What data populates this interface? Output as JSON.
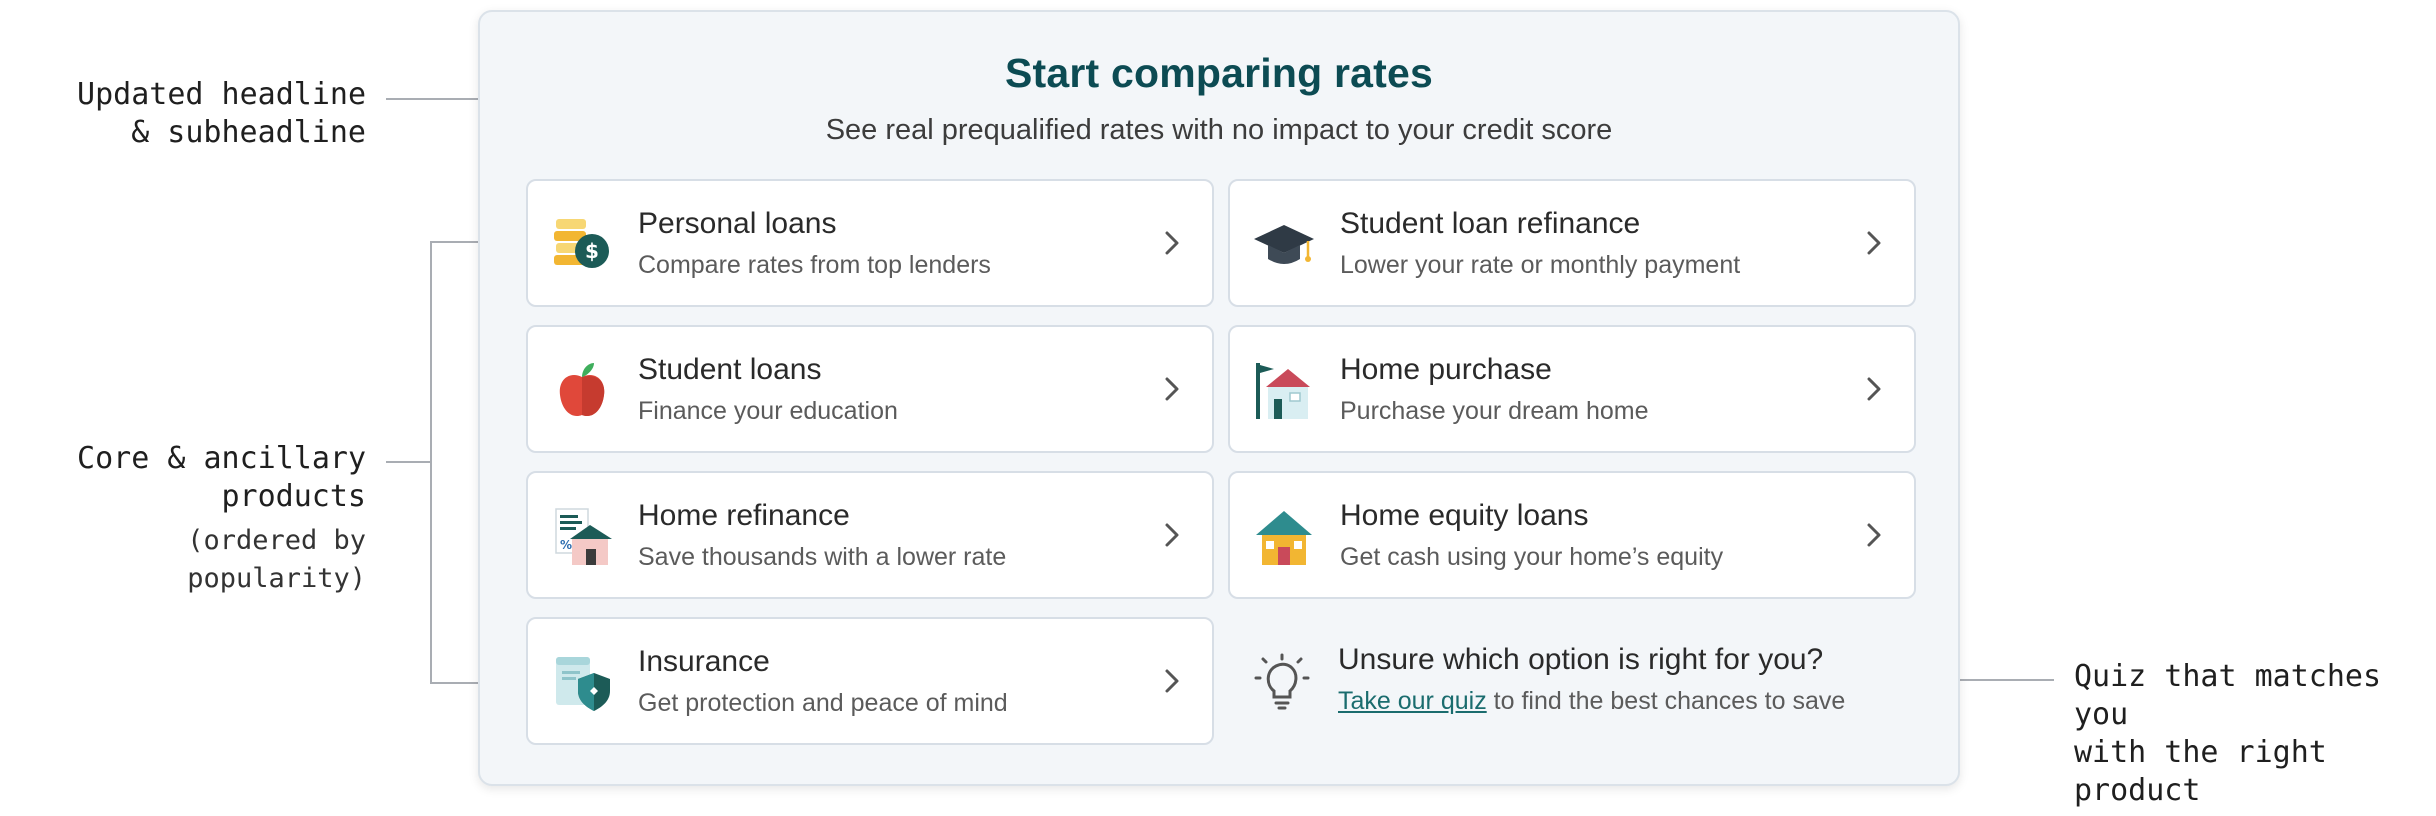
{
  "annotations": {
    "headline": [
      "Updated headline",
      "& subheadline"
    ],
    "products": [
      "Core & ancillary",
      "products"
    ],
    "products_note": "(ordered by popularity)",
    "quiz": [
      "Quiz that matches you",
      "with the right product"
    ]
  },
  "panel": {
    "title": "Start comparing rates",
    "subtitle": "See real prequalified rates with no impact to your credit score"
  },
  "products": [
    {
      "title": "Personal loans",
      "desc": "Compare rates from top lenders",
      "icon": "coins-stack-icon"
    },
    {
      "title": "Student loan refinance",
      "desc": "Lower your rate or monthly payment",
      "icon": "graduation-cap-icon"
    },
    {
      "title": "Student loans",
      "desc": "Finance your education",
      "icon": "apple-icon"
    },
    {
      "title": "Home purchase",
      "desc": "Purchase your dream home",
      "icon": "house-with-flag-icon"
    },
    {
      "title": "Home refinance",
      "desc": "Save thousands with a lower rate",
      "icon": "house-document-icon"
    },
    {
      "title": "Home equity loans",
      "desc": "Get cash using your home’s equity",
      "icon": "house-icon"
    },
    {
      "title": "Insurance",
      "desc": "Get protection and peace of mind",
      "icon": "shield-document-icon"
    }
  ],
  "quiz": {
    "title": "Unsure which option is right for you?",
    "link_text": "Take our quiz",
    "desc_rest": " to find the best chances to save",
    "icon": "lightbulb-icon"
  },
  "colors": {
    "title_teal": "#0c4b53",
    "link_teal": "#1a6c6e",
    "panel_bg": "#f3f6f9"
  }
}
